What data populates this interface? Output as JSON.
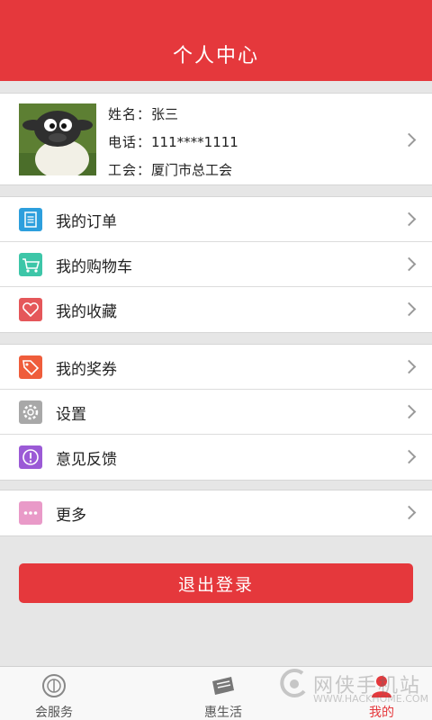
{
  "header": {
    "title": "个人中心"
  },
  "profile": {
    "name_label": "姓名：",
    "name_value": "张三",
    "phone_label": "电话：",
    "phone_value": "111****1111",
    "union_label": "工会：",
    "union_value": "厦门市总工会"
  },
  "menu_groups": [
    {
      "items": [
        {
          "label": "我的订单",
          "icon": "order-icon",
          "color": "#2d9fdd"
        },
        {
          "label": "我的购物车",
          "icon": "cart-icon",
          "color": "#3dc6a8"
        },
        {
          "label": "我的收藏",
          "icon": "heart-icon",
          "color": "#e5575a"
        }
      ]
    },
    {
      "items": [
        {
          "label": "我的奖券",
          "icon": "coupon-icon",
          "color": "#ef5d3b"
        },
        {
          "label": "设置",
          "icon": "gear-icon",
          "color": "#a8a8a8"
        },
        {
          "label": "意见反馈",
          "icon": "feedback-icon",
          "color": "#9b5ad6"
        }
      ]
    },
    {
      "items": [
        {
          "label": "更多",
          "icon": "more-icon",
          "color": "#e99ac8"
        }
      ]
    }
  ],
  "logout_label": "退出登录",
  "tabbar": {
    "tabs": [
      {
        "label": "会服务",
        "icon": "union-service-icon"
      },
      {
        "label": "惠生活",
        "icon": "ticket-icon"
      },
      {
        "label": "",
        "icon": ""
      },
      {
        "label": "我的",
        "icon": "person-icon",
        "active": true
      }
    ]
  },
  "watermark": {
    "brand": "网侠手机站",
    "url": "WWW.HACKHOME.COM"
  },
  "colors": {
    "accent": "#e5383c"
  }
}
